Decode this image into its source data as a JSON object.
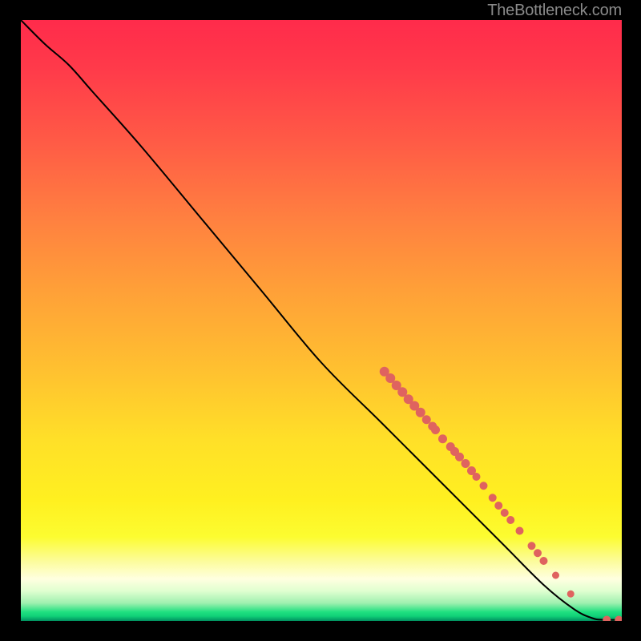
{
  "attribution": "TheBottleneck.com",
  "chart_data": {
    "type": "line",
    "title": "",
    "xlabel": "",
    "ylabel": "",
    "xlim": [
      0,
      100
    ],
    "ylim": [
      0,
      100
    ],
    "curve": [
      {
        "x": 0,
        "y": 100
      },
      {
        "x": 4,
        "y": 96
      },
      {
        "x": 8,
        "y": 92.5
      },
      {
        "x": 12,
        "y": 88
      },
      {
        "x": 20,
        "y": 79
      },
      {
        "x": 30,
        "y": 67
      },
      {
        "x": 40,
        "y": 55
      },
      {
        "x": 50,
        "y": 43
      },
      {
        "x": 60,
        "y": 33
      },
      {
        "x": 70,
        "y": 23
      },
      {
        "x": 80,
        "y": 13
      },
      {
        "x": 87,
        "y": 6
      },
      {
        "x": 92,
        "y": 2
      },
      {
        "x": 95,
        "y": 0.5
      },
      {
        "x": 97,
        "y": 0.2
      },
      {
        "x": 100,
        "y": 0.2
      }
    ],
    "markers": [
      {
        "x": 60.5,
        "y": 41.5,
        "r": 6
      },
      {
        "x": 61.5,
        "y": 40.4,
        "r": 6
      },
      {
        "x": 62.5,
        "y": 39.2,
        "r": 6
      },
      {
        "x": 63.5,
        "y": 38.1,
        "r": 6
      },
      {
        "x": 64.5,
        "y": 36.9,
        "r": 6
      },
      {
        "x": 65.5,
        "y": 35.8,
        "r": 6
      },
      {
        "x": 66.5,
        "y": 34.7,
        "r": 6
      },
      {
        "x": 67.5,
        "y": 33.5,
        "r": 5.5
      },
      {
        "x": 68.5,
        "y": 32.4,
        "r": 5.5
      },
      {
        "x": 69.0,
        "y": 31.8,
        "r": 5.5
      },
      {
        "x": 70.2,
        "y": 30.3,
        "r": 5.5
      },
      {
        "x": 71.5,
        "y": 29.0,
        "r": 5.5
      },
      {
        "x": 72.2,
        "y": 28.2,
        "r": 5.5
      },
      {
        "x": 73.0,
        "y": 27.3,
        "r": 5.5
      },
      {
        "x": 74.0,
        "y": 26.2,
        "r": 5.5
      },
      {
        "x": 75.0,
        "y": 25.0,
        "r": 5.5
      },
      {
        "x": 75.8,
        "y": 24.0,
        "r": 5
      },
      {
        "x": 77.0,
        "y": 22.5,
        "r": 5
      },
      {
        "x": 78.5,
        "y": 20.5,
        "r": 5
      },
      {
        "x": 79.5,
        "y": 19.2,
        "r": 5
      },
      {
        "x": 80.5,
        "y": 18.0,
        "r": 5
      },
      {
        "x": 81.5,
        "y": 16.8,
        "r": 5
      },
      {
        "x": 83.0,
        "y": 15.0,
        "r": 5
      },
      {
        "x": 85.0,
        "y": 12.5,
        "r": 5
      },
      {
        "x": 86.0,
        "y": 11.3,
        "r": 5
      },
      {
        "x": 87.0,
        "y": 10.0,
        "r": 5
      },
      {
        "x": 89.0,
        "y": 7.6,
        "r": 4.5
      },
      {
        "x": 91.5,
        "y": 4.5,
        "r": 4.5
      },
      {
        "x": 97.5,
        "y": 0.2,
        "r": 5
      },
      {
        "x": 99.5,
        "y": 0.2,
        "r": 5
      }
    ],
    "marker_color": "#df635f",
    "curve_color": "#000000"
  },
  "colors": {
    "background": "#000000",
    "attribution": "#8a8a8a"
  }
}
